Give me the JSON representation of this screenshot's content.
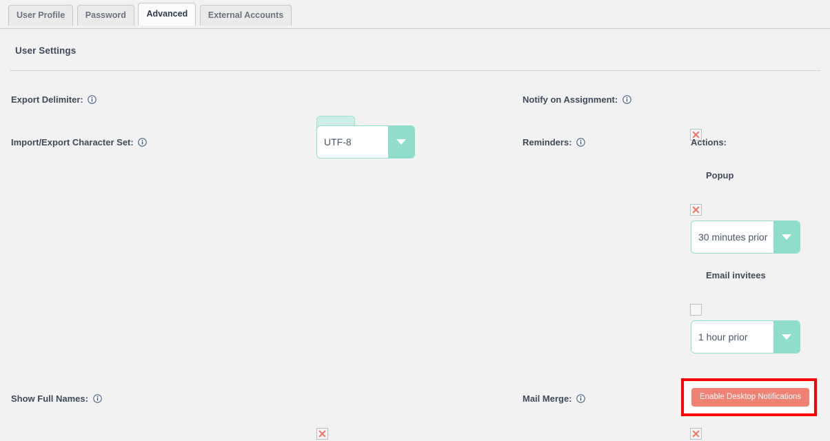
{
  "tabs": [
    {
      "label": "User Profile",
      "active": false
    },
    {
      "label": "Password",
      "active": false
    },
    {
      "label": "Advanced",
      "active": true
    },
    {
      "label": "External Accounts",
      "active": false
    }
  ],
  "panel": {
    "title": "User Settings"
  },
  "fields": {
    "export_delimiter": {
      "label": "Export Delimiter:",
      "value": ","
    },
    "character_set": {
      "label": "Import/Export Character Set:",
      "value": "UTF-8"
    },
    "notify_on_assignment": {
      "label": "Notify on Assignment:",
      "checked": true
    },
    "reminders": {
      "label": "Reminders:"
    },
    "actions": {
      "label": "Actions:",
      "popup": {
        "label": "Popup",
        "checked": true,
        "value": "30 minutes prior"
      },
      "email_invitees": {
        "label": "Email invitees",
        "checked": false,
        "value": "1 hour prior"
      },
      "enable_desktop_notifications": {
        "label": "Enable Desktop Notifications"
      }
    },
    "show_full_names": {
      "label": "Show Full Names:",
      "checked": true
    },
    "mail_merge": {
      "label": "Mail Merge:",
      "checked": true
    }
  },
  "icons": {
    "info": "info-circle-icon",
    "checked": "red-x-icon",
    "dropdown": "chevron-down-icon"
  },
  "colors": {
    "page_bg": "#f2f2f2",
    "teal_accent": "#8fdecb",
    "teal_fill": "#cdeee6",
    "red_x": "#ef7767",
    "button_salmon": "#ef8273",
    "annotation_red": "#ff0000",
    "label_text": "#3f4a5a"
  }
}
